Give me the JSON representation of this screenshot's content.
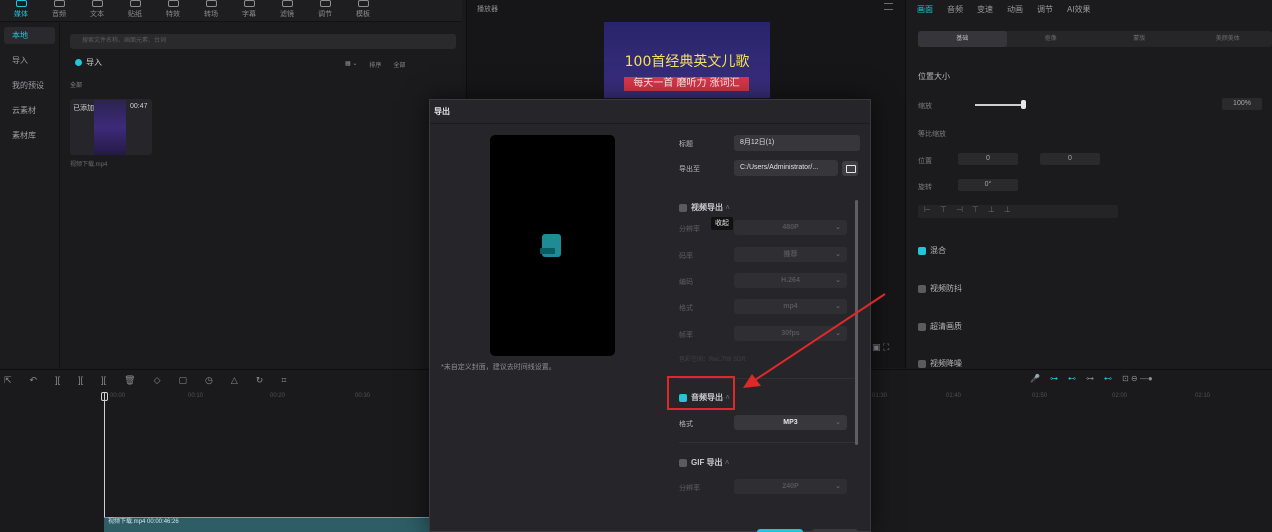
{
  "toolbar": {
    "items": [
      "媒体",
      "音频",
      "文本",
      "贴纸",
      "特效",
      "转场",
      "字幕",
      "滤镜",
      "调节",
      "模板"
    ]
  },
  "sidebar": {
    "items": [
      "本地",
      "导入",
      "我的预设",
      "云素材",
      "素材库"
    ]
  },
  "media": {
    "search_placeholder": "搜索文件名称、画面元素、台词",
    "import_label": "导入",
    "sort_label": "排序",
    "filter_label": "全部",
    "all_label": "全部",
    "added_label": "已添加",
    "duration": "00:47",
    "filename": "视频下载.mp4"
  },
  "player": {
    "title": "播放器",
    "video_line1": "100首经典英文儿歌",
    "video_line2": "每天一首 磨听力 涨词汇"
  },
  "props": {
    "tabs": [
      "画面",
      "音频",
      "变速",
      "动画",
      "调节",
      "AI效果"
    ],
    "subtabs": [
      "基础",
      "抠像",
      "蒙版",
      "美颜美体"
    ],
    "position_size": "位置大小",
    "scale_label": "缩放",
    "scale_value": "100%",
    "uniform_scale": "等比缩放",
    "position_label": "位置",
    "pos_x": "0",
    "pos_y": "0",
    "rotate_label": "旋转",
    "rotate_value": "0°",
    "blend": "混合",
    "stabilize": "视频防抖",
    "hd": "超清画质",
    "denoise": "视频降噪"
  },
  "timeline": {
    "ruler": [
      "00:00",
      "00:10",
      "00:20",
      "00:30",
      "01:30",
      "01:40",
      "01:50",
      "02:00",
      "02:10"
    ],
    "clip_label": "视频下载.mp4  00:00:46:26"
  },
  "modal": {
    "title": "导出",
    "title_label": "标题",
    "title_value": "8月12日(1)",
    "export_to_label": "导出至",
    "export_to_value": "C:/Users/Administrator/...",
    "cover_note": "*未自定义封面，建议去时间线设置。",
    "video_export": "视频导出",
    "resolution_label": "分辨率",
    "resolution_value": "480P",
    "bitrate_label": "码率",
    "bitrate_value": "推荐",
    "codec_label": "编码",
    "codec_value": "H.264",
    "format_label": "格式",
    "format_value": "mp4",
    "framerate_label": "帧率",
    "framerate_value": "30fps",
    "color_space": "色彩空间：Rec.709 SDR",
    "audio_export": "音频导出",
    "audio_format_label": "格式",
    "audio_format_value": "MP3",
    "gif_export": "GIF 导出",
    "gif_res_label": "分辨率",
    "gif_res_value": "240P",
    "tooltip": "收起"
  }
}
